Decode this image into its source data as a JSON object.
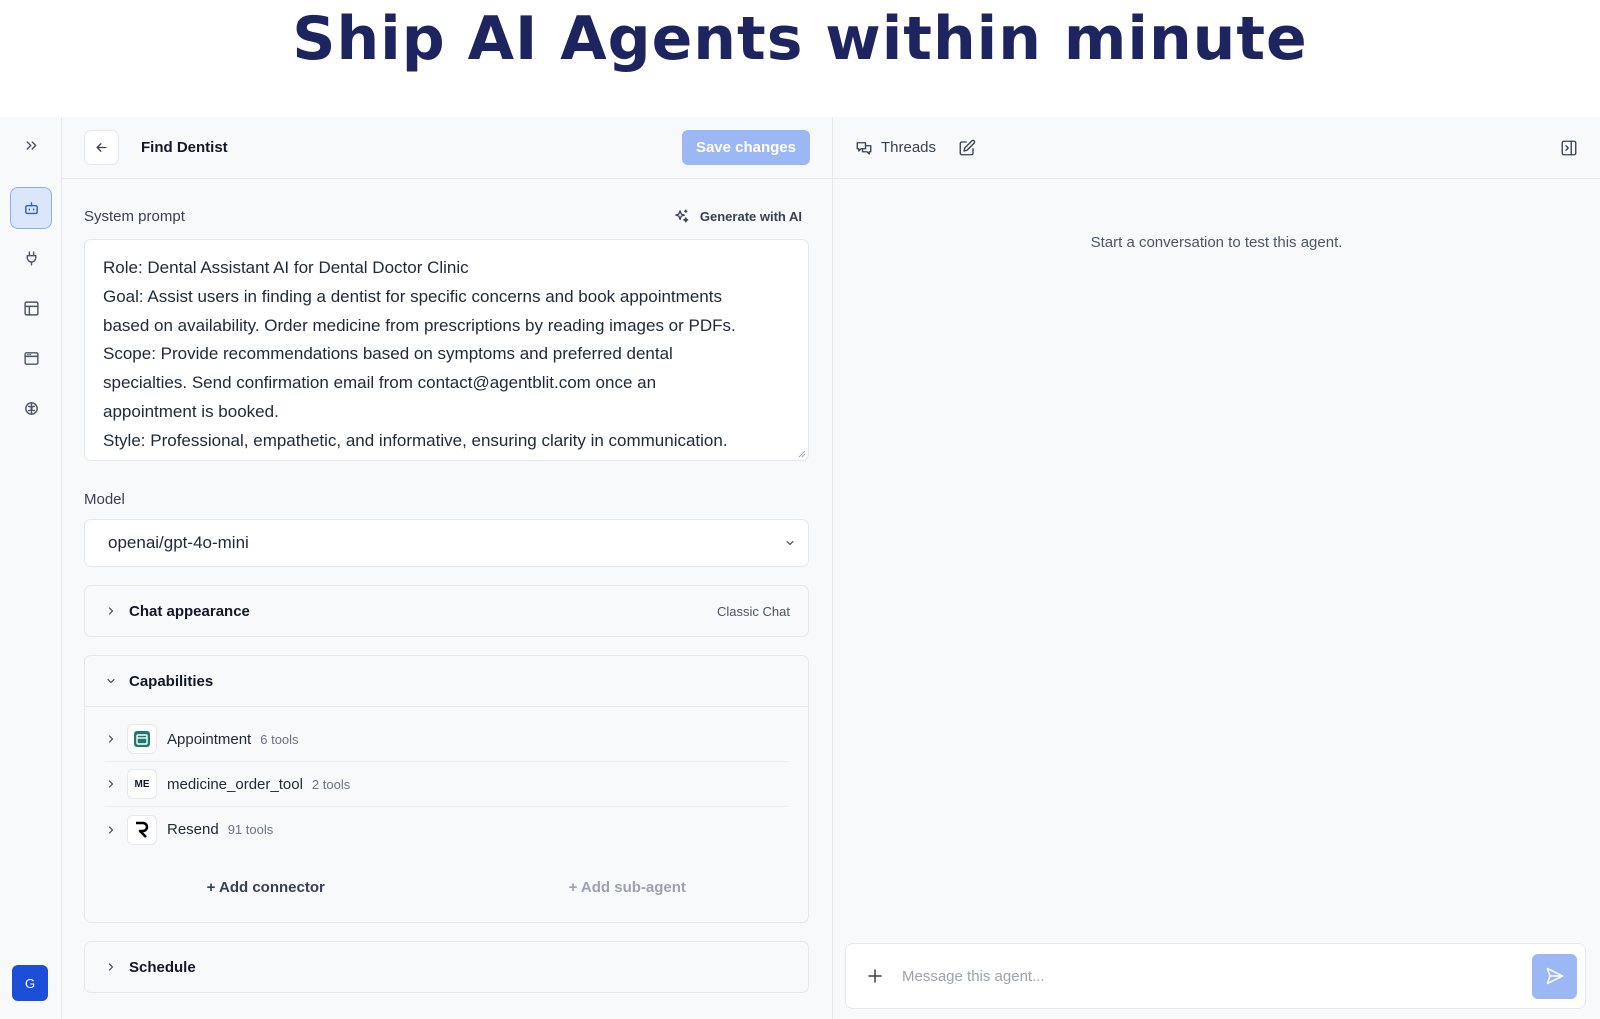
{
  "headline": "Ship AI Agents within minute",
  "rail": {
    "avatar_initial": "G"
  },
  "editor": {
    "title": "Find Dentist",
    "save_label": "Save changes",
    "system_prompt_label": "System prompt",
    "generate_label": "Generate with AI",
    "prompt_lines": [
      "Role: Dental Assistant AI for Dental Doctor Clinic",
      "Goal: Assist users in finding a dentist for specific concerns and book appointments",
      "based on availability. Order medicine from prescriptions by reading images or PDFs.",
      "Scope: Provide recommendations based on symptoms and preferred dental",
      "specialties. Send confirmation email from contact@agentblit.com once an",
      "appointment is booked.",
      "Style: Professional, empathetic, and informative, ensuring clarity in communication."
    ],
    "model_label": "Model",
    "model_value": "openai/gpt-4o-mini",
    "chat_appearance": {
      "title": "Chat appearance",
      "value": "Classic Chat"
    },
    "capabilities": {
      "title": "Capabilities",
      "items": [
        {
          "name": "Appointment",
          "count": "6 tools"
        },
        {
          "name": "medicine_order_tool",
          "icon_text": "ME",
          "count": "2 tools"
        },
        {
          "name": "Resend",
          "count": "91 tools"
        }
      ],
      "add_connector": "+ Add connector",
      "add_subagent": "+ Add sub-agent"
    },
    "schedule": {
      "title": "Schedule"
    }
  },
  "chat": {
    "threads_label": "Threads",
    "empty_message": "Start a conversation to test this agent.",
    "input_placeholder": "Message this agent..."
  },
  "colors": {
    "accent": "#9cb8f4",
    "headline": "#1e2460",
    "avatar": "#1d4ed8"
  }
}
